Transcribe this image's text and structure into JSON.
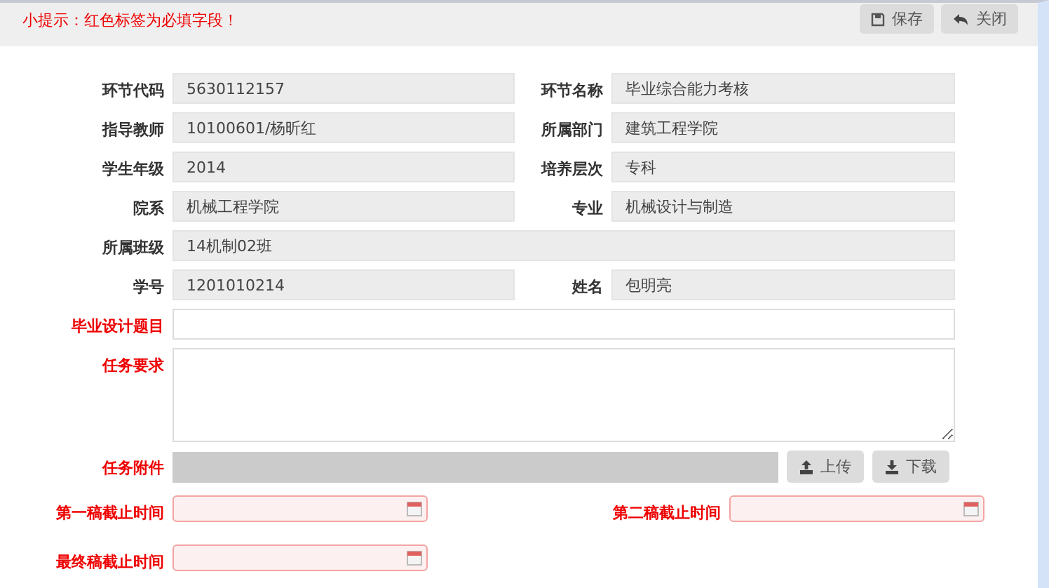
{
  "hint": "小提示：红色标签为必填字段！",
  "toolbar_buttons": [
    {
      "label": "保存"
    },
    {
      "label": "关闭"
    }
  ],
  "rows": [
    {
      "fields": [
        {
          "label": "环节代码",
          "kind": "readonly",
          "value": "5630112157",
          "required": false
        },
        {
          "label": "环节名称",
          "kind": "readonly",
          "value": "毕业综合能力考核",
          "required": false
        }
      ]
    },
    {
      "fields": [
        {
          "label": "指导教师",
          "kind": "readonly",
          "value": "10100601/杨昕红",
          "required": false
        },
        {
          "label": "所属部门",
          "kind": "readonly",
          "value": "建筑工程学院",
          "required": false
        }
      ]
    },
    {
      "fields": [
        {
          "label": "学生年级",
          "kind": "readonly",
          "value": "2014",
          "required": false
        },
        {
          "label": "培养层次",
          "kind": "readonly",
          "value": "专科",
          "required": false
        }
      ]
    },
    {
      "fields": [
        {
          "label": "院系",
          "kind": "readonly",
          "value": "机械工程学院",
          "required": false
        },
        {
          "label": "专业",
          "kind": "readonly",
          "value": "机械设计与制造",
          "required": false
        }
      ]
    },
    {
      "fields": [
        {
          "label": "所属班级",
          "kind": "readonly",
          "value": "14机制02班",
          "required": false
        }
      ]
    },
    {
      "fields": [
        {
          "label": "学号",
          "kind": "readonly",
          "value": "1201010214",
          "required": false
        },
        {
          "label": "姓名",
          "kind": "readonly",
          "value": "包明亮",
          "required": false
        }
      ]
    },
    {
      "fields": [
        {
          "label": "毕业设计题目",
          "kind": "text",
          "required": true
        }
      ]
    },
    {
      "fields": [
        {
          "label": "任务要求",
          "kind": "textarea",
          "required": true
        }
      ]
    },
    {
      "fields": [
        {
          "label": "任务附件",
          "kind": "file",
          "required": true,
          "buttons": [
            {
              "label": "上传"
            },
            {
              "label": "下载"
            }
          ]
        }
      ]
    },
    {
      "fields": [
        {
          "label": "第一稿截止时间",
          "kind": "date",
          "required": true
        },
        {
          "label": "第二稿截止时间",
          "kind": "date",
          "required": true
        }
      ]
    },
    {
      "fields": [
        {
          "label": "最终稿截止时间",
          "kind": "date",
          "required": true
        }
      ]
    }
  ]
}
